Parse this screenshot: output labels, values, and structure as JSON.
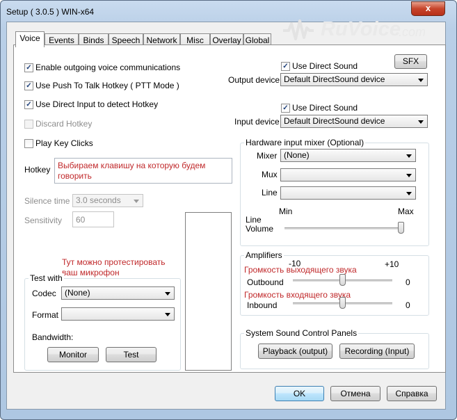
{
  "window": {
    "title": "Setup ( 3.0.5 ) WIN-x64",
    "close_glyph": "x"
  },
  "watermark": {
    "text": "RuVoice",
    "suffix": ".com"
  },
  "tabs": [
    "Voice",
    "Events",
    "Binds",
    "Speech",
    "Network",
    "Misc",
    "Overlay",
    "Global"
  ],
  "active_tab": "Voice",
  "options": {
    "enable_outgoing": {
      "label": "Enable outgoing voice communications",
      "checked": true
    },
    "push_to_talk": {
      "label": "Use Push To Talk Hotkey ( PTT Mode )",
      "checked": true
    },
    "direct_input": {
      "label": "Use Direct Input to detect Hotkey",
      "checked": true
    },
    "discard_hotkey": {
      "label": "Discard Hotkey",
      "checked": false,
      "disabled": true
    },
    "play_key_clicks": {
      "label": "Play Key Clicks",
      "checked": false
    }
  },
  "hotkey": {
    "label": "Hotkey",
    "note": "Выбираем клавишу на которую будем говорить"
  },
  "silence": {
    "label": "Silence time",
    "value": "3.0 seconds"
  },
  "sensitivity": {
    "label": "Sensitivity",
    "value": "60"
  },
  "test_note": "Тут можно протестировать ваш микрофон",
  "test_with": {
    "title": "Test with",
    "codec_label": "Codec",
    "codec_value": "(None)",
    "format_label": "Format",
    "format_value": "",
    "bandwidth_label": "Bandwidth:",
    "monitor": "Monitor",
    "test": "Test"
  },
  "sfx_button": "SFX",
  "output": {
    "direct_sound_label": "Use Direct Sound",
    "checked": true,
    "device_label": "Output device",
    "device_value": "Default DirectSound device"
  },
  "input": {
    "direct_sound_label": "Use Direct Sound",
    "checked": true,
    "device_label": "Input device",
    "device_value": "Default DirectSound device"
  },
  "hw_mixer": {
    "title": "Hardware input mixer (Optional)",
    "mixer_label": "Mixer",
    "mixer_value": "(None)",
    "mux_label": "Mux",
    "mux_value": "",
    "line_label": "Line",
    "line_value": "",
    "min_label": "Min",
    "max_label": "Max",
    "line_volume_label": "Line Volume",
    "line_volume_level": 1.0
  },
  "amplifiers": {
    "title": "Amplifiers",
    "minus": "-10",
    "plus": "+10",
    "outbound_note": "Громкость выходящего звука",
    "outbound_label": "Outbound",
    "outbound_value": "0",
    "outbound_level": 0.5,
    "inbound_note": "Громкость входящего звука",
    "inbound_label": "Inbound",
    "inbound_value": "0",
    "inbound_level": 0.5
  },
  "sound_panels": {
    "title": "System Sound Control Panels",
    "playback": "Playback (output)",
    "recording": "Recording (Input)"
  },
  "footer": {
    "ok": "OK",
    "cancel": "Отмена",
    "help": "Справка"
  },
  "colors": {
    "accent_red": "#c0282a",
    "window_frame": "#b9cfe7",
    "default_button": "#3c7fb1"
  }
}
